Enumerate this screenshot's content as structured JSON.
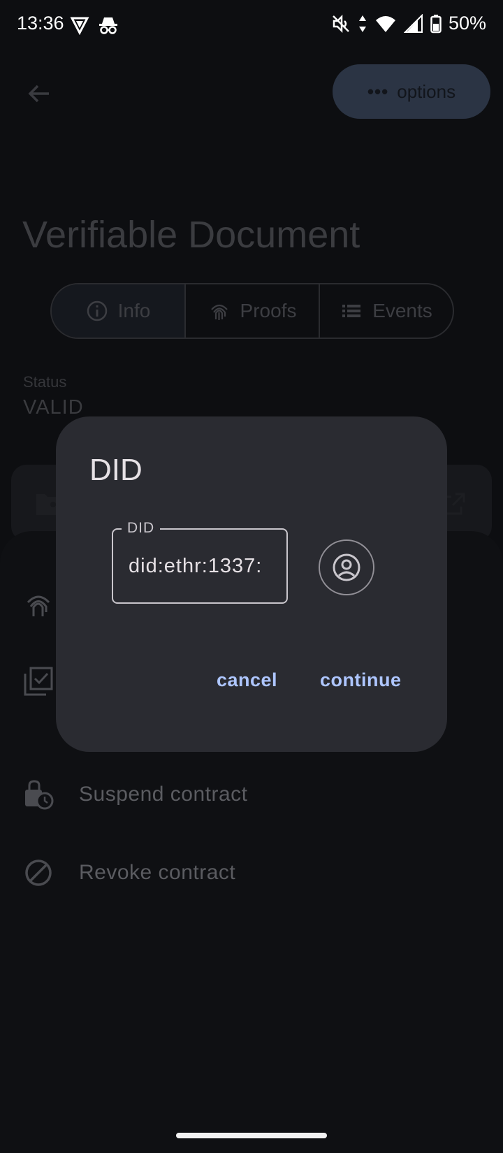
{
  "status_bar": {
    "time": "13:36",
    "battery_text": "50%"
  },
  "appbar": {
    "options_label": "options"
  },
  "page": {
    "title": "Verifiable Document",
    "tabs": [
      {
        "label": "Info",
        "icon": "info-icon"
      },
      {
        "label": "Proofs",
        "icon": "fingerprint-icon"
      },
      {
        "label": "Events",
        "icon": "list-icon"
      }
    ],
    "status_label": "Status",
    "status_value": "VALID"
  },
  "sheet": {
    "items": [
      {
        "label": "Suspend contract",
        "icon": "lock-clock-icon"
      },
      {
        "label": "Revoke contract",
        "icon": "block-icon"
      }
    ]
  },
  "dialog": {
    "title": "DID",
    "field_label": "DID",
    "field_value": "did:ethr:1337:",
    "cancel_label": "cancel",
    "continue_label": "continue"
  },
  "colors": {
    "accent": "#aec6ff",
    "dialog_bg": "#2a2b31",
    "background": "#0d0e11"
  }
}
